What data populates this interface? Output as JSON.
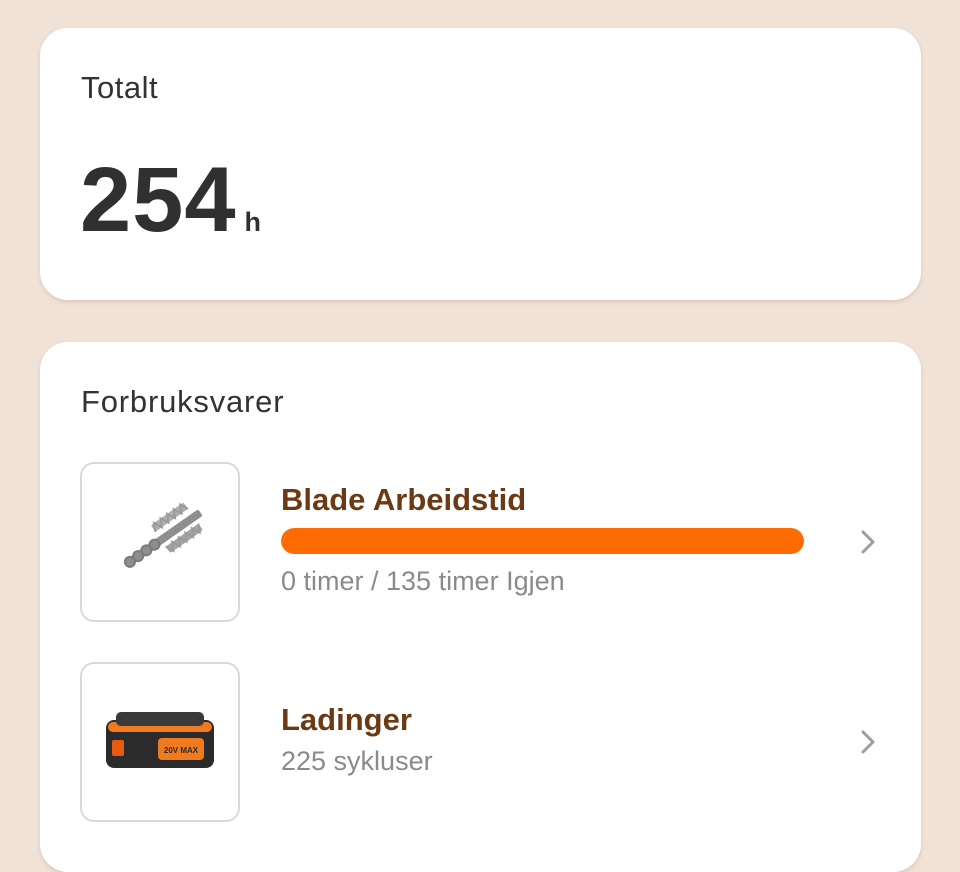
{
  "total": {
    "label": "Totalt",
    "value": "254",
    "unit": "h"
  },
  "consumables": {
    "title": "Forbruksvarer",
    "items": [
      {
        "name": "Blade Arbeidstid",
        "icon": "hedge-trimmer-blade-icon",
        "progress": 1.0,
        "progress_color": "#fe6b00",
        "subtitle": "0 timer / 135 timer Igjen"
      },
      {
        "name": "Ladinger",
        "icon": "battery-pack-icon",
        "subtitle": "225 sykluser",
        "battery_label": "20V MAX"
      }
    ]
  },
  "colors": {
    "background": "#f0e2d7",
    "accent": "#fe6b00",
    "item_title": "#6b3a14"
  }
}
